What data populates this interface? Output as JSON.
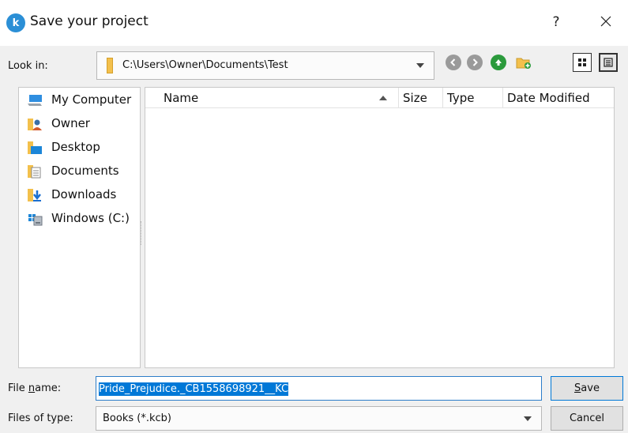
{
  "window": {
    "title": "Save your project",
    "app_icon_letter": "k",
    "help_label": "?",
    "close_label": "×"
  },
  "look_in": {
    "label": "Look in:",
    "path": "C:\\Users\\Owner\\Documents\\Test"
  },
  "toolbar": {
    "back_icon": "back-arrow-icon",
    "forward_icon": "forward-arrow-icon",
    "up_icon": "up-arrow-icon",
    "new_folder_icon": "new-folder-icon",
    "list_view_icon": "list-view-icon",
    "detail_view_icon": "detail-view-icon"
  },
  "places": [
    {
      "label": "My Computer",
      "icon": "computer-icon"
    },
    {
      "label": "Owner",
      "icon": "user-icon"
    },
    {
      "label": "Desktop",
      "icon": "desktop-folder-icon"
    },
    {
      "label": "Documents",
      "icon": "documents-folder-icon"
    },
    {
      "label": "Downloads",
      "icon": "downloads-folder-icon"
    },
    {
      "label": "Windows (C:)",
      "icon": "drive-icon"
    }
  ],
  "columns": {
    "name": "Name",
    "size": "Size",
    "type": "Type",
    "date_modified": "Date Modified"
  },
  "file_name": {
    "label_prefix": "File ",
    "label_underlined": "n",
    "label_suffix": "ame:",
    "value": "Pride_Prejudice._CB1558698921__KC"
  },
  "file_type": {
    "label": "Files of type:",
    "value": "Books (*.kcb)"
  },
  "buttons": {
    "save_underlined": "S",
    "save_rest": "ave",
    "cancel": "Cancel"
  },
  "colors": {
    "accent": "#0078d7",
    "dialog_bg": "#f0f0f0",
    "folder": "#f3c04c"
  }
}
